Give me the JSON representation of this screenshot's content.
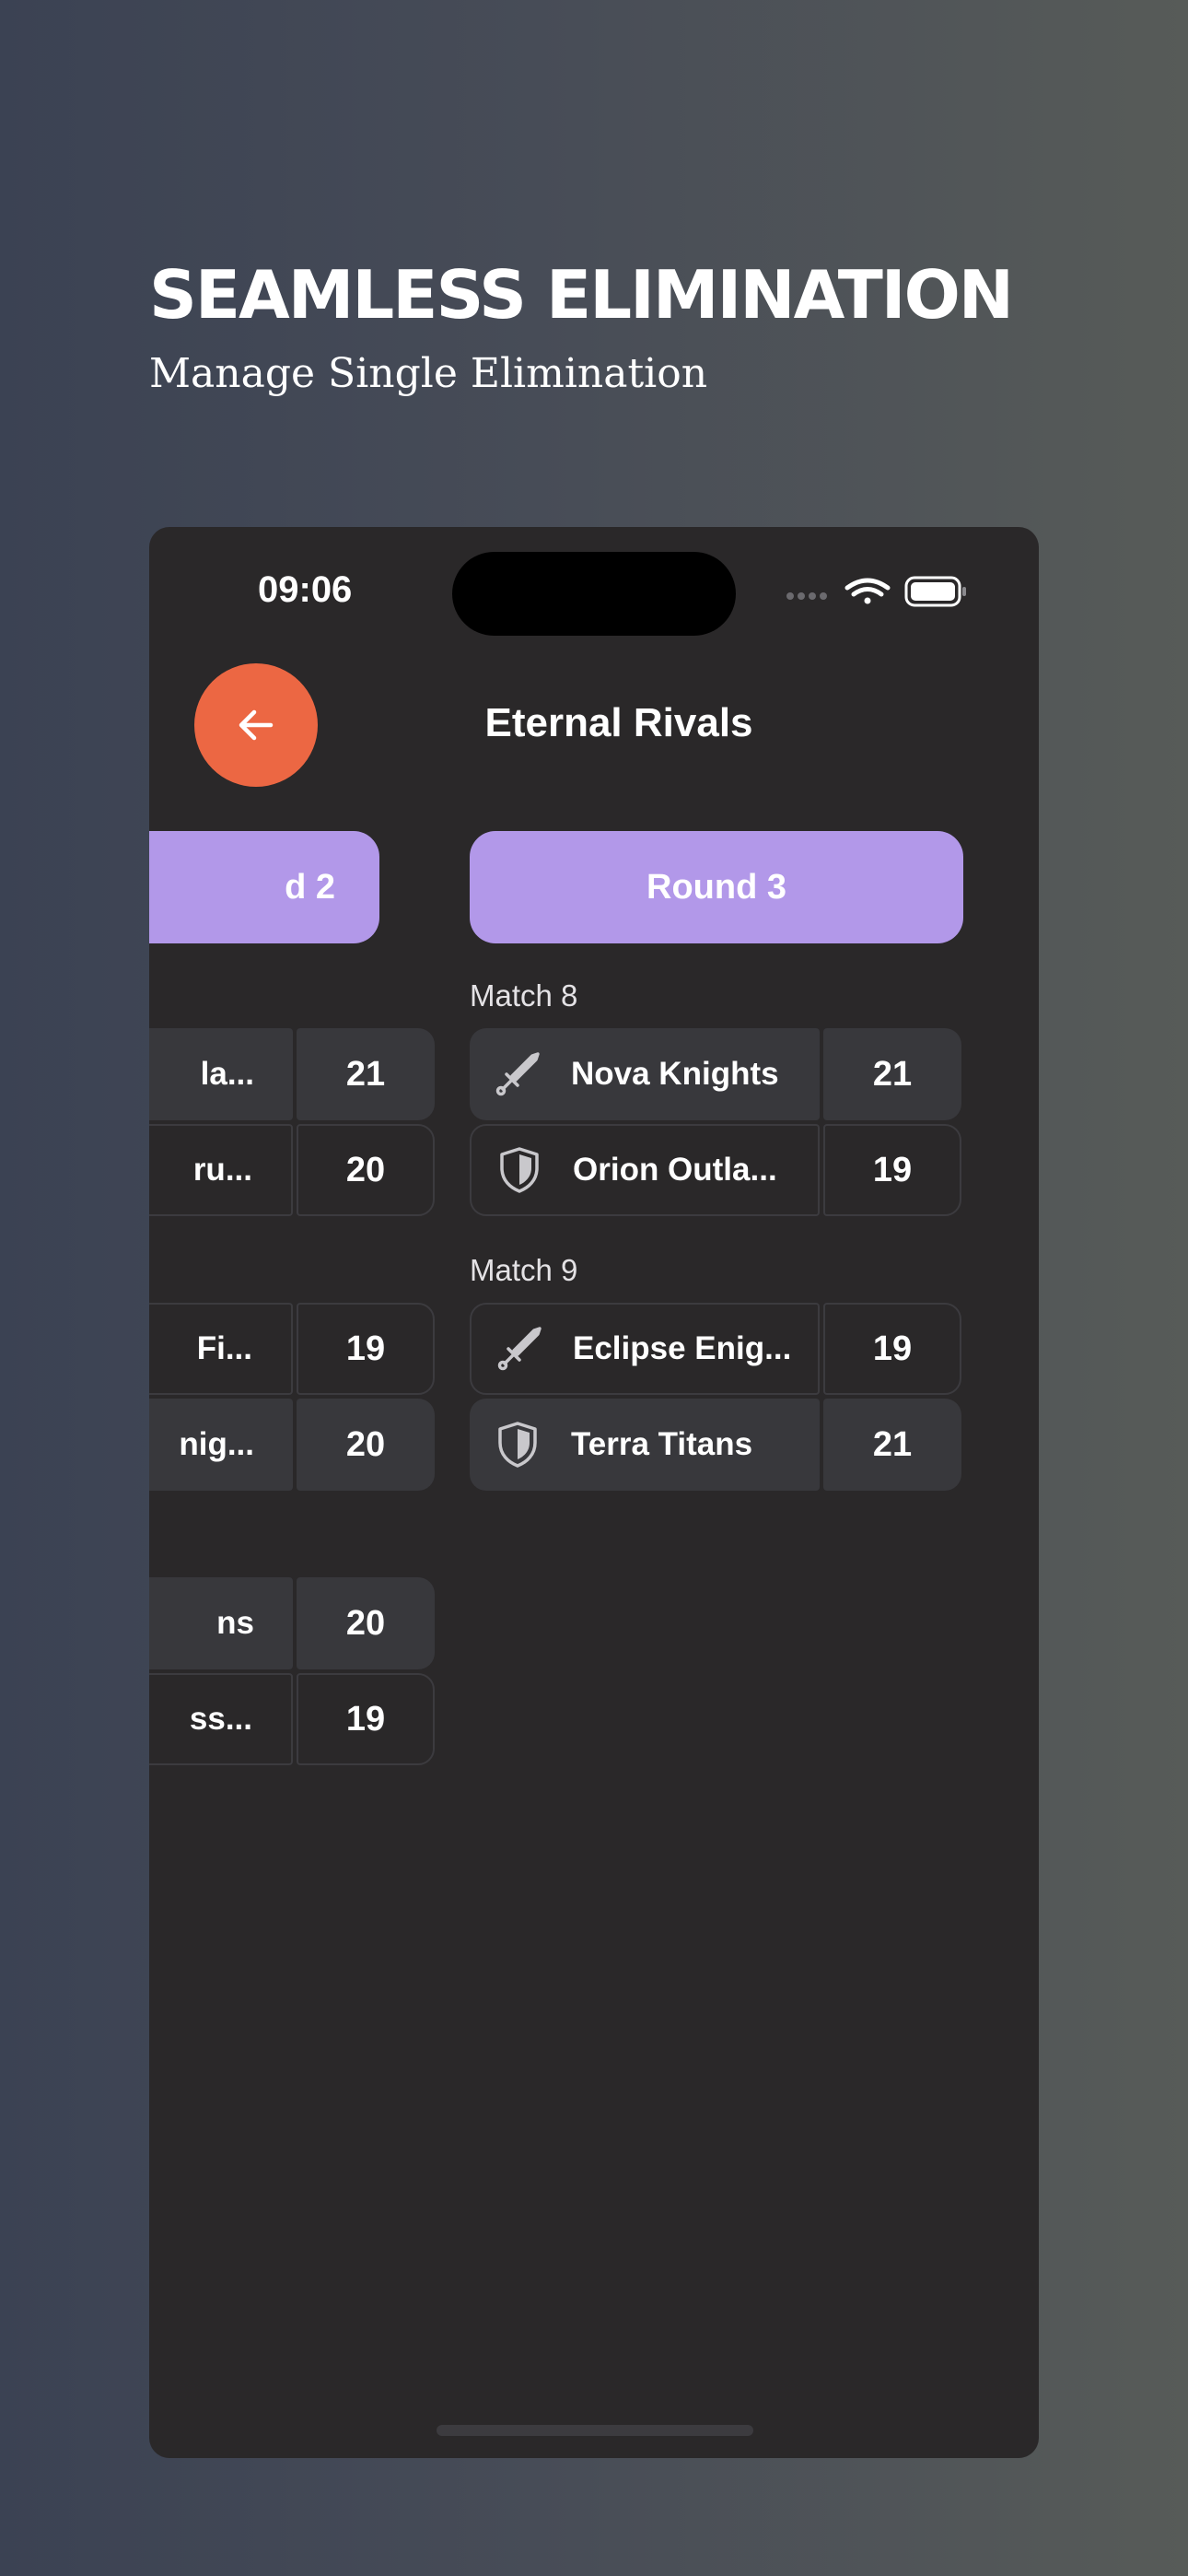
{
  "promo": {
    "headline": "SEAMLESS ELIMINATION",
    "subline": "Manage Single Elimination"
  },
  "status_bar": {
    "time": "09:06",
    "icons": [
      "signal-dots-icon",
      "wifi-icon",
      "battery-icon"
    ]
  },
  "header": {
    "title": "Eternal Rivals",
    "back_icon": "arrow-left-icon"
  },
  "colors": {
    "accent": "#ec6743",
    "round_pill": "#b298e9",
    "card": "#38383c",
    "screen_bg": "#2a2829"
  },
  "previous_round": {
    "label_visible": "d 2",
    "matches": [
      {
        "teams": [
          {
            "name": "la...",
            "score": "21"
          },
          {
            "name": "ru...",
            "score": "20"
          }
        ]
      },
      {
        "teams": [
          {
            "name": "Fi...",
            "score": "19"
          },
          {
            "name": "nig...",
            "score": "20"
          }
        ]
      },
      {
        "teams": [
          {
            "name": "ns",
            "score": "20"
          },
          {
            "name": "ss...",
            "score": "19"
          }
        ]
      }
    ]
  },
  "current_round": {
    "label": "Round 3",
    "matches": [
      {
        "label": "Match 8",
        "teams": [
          {
            "name": "Nova Knights",
            "score": "21",
            "icon": "sword-icon"
          },
          {
            "name": "Orion Outla...",
            "score": "19",
            "icon": "shield-icon"
          }
        ]
      },
      {
        "label": "Match 9",
        "teams": [
          {
            "name": "Eclipse Enig...",
            "score": "19",
            "icon": "sword-icon"
          },
          {
            "name": "Terra Titans",
            "score": "21",
            "icon": "shield-icon"
          }
        ]
      }
    ]
  }
}
